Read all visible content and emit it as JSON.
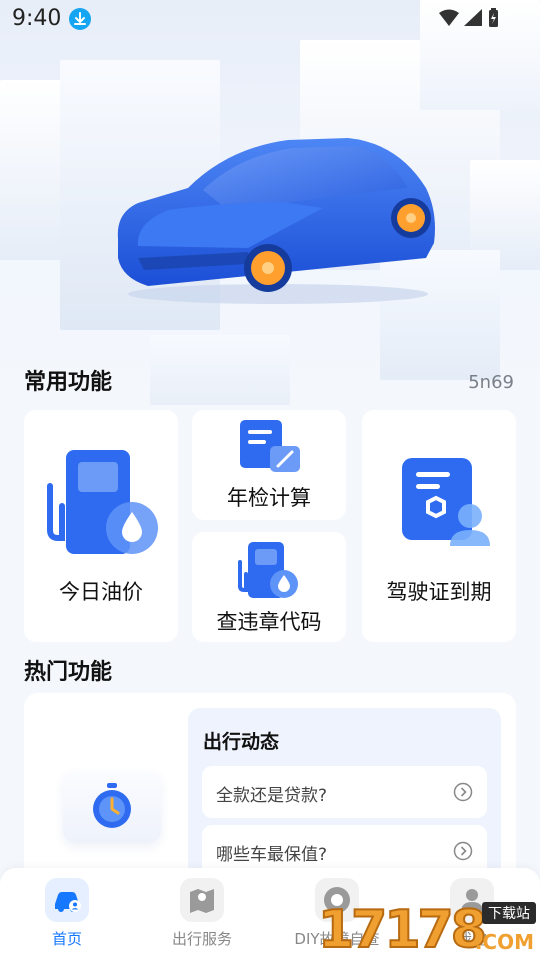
{
  "status_bar": {
    "time": "9:40"
  },
  "common": {
    "title": "常用功能",
    "code": "5n69",
    "cards": {
      "fuel_price": "今日油价",
      "inspection_calc": "年检计算",
      "violation_code": "查违章代码",
      "license_expiry": "驾驶证到期"
    }
  },
  "hot": {
    "title": "热门功能",
    "trends": {
      "title": "出行动态",
      "items": [
        "全款还是贷款?",
        "哪些车最保值?"
      ]
    }
  },
  "tabbar": {
    "tabs": [
      {
        "label": "首页",
        "icon": "car-home-icon"
      },
      {
        "label": "出行服务",
        "icon": "map-icon"
      },
      {
        "label": "DIY故障自查",
        "icon": "wheel-icon"
      },
      {
        "label": "我的",
        "icon": "user-icon"
      }
    ]
  },
  "watermark": {
    "digits": "17178",
    "tag": "下载站",
    "suffix": ".COM"
  },
  "colors": {
    "accent": "#1677ff",
    "card_icon_blue": "#2f6bf0",
    "car_blue": "#2457e0",
    "wheel_orange": "#ff9f2e"
  }
}
